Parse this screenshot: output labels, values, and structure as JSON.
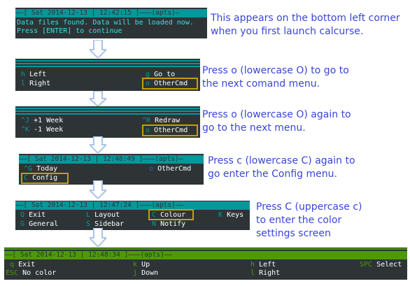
{
  "screens": {
    "s1": {
      "header": "——[ Sat 2014-12-13 | 12:42:15 ]———(apts)—",
      "line1": "Data files found. Data will be loaded now.",
      "line2": "Press [ENTER] to continue"
    },
    "s2": {
      "items": [
        {
          "key": "h",
          "label": "Left"
        },
        {
          "key": "l",
          "label": "Right"
        },
        {
          "key": "g",
          "label": "Go to"
        },
        {
          "key": "o",
          "label": "OtherCmd"
        }
      ]
    },
    "s3": {
      "items": [
        {
          "key": "^J",
          "label": "+1 Week"
        },
        {
          "key": "^K",
          "label": "-1 Week"
        },
        {
          "key": "^R",
          "label": "Redraw"
        },
        {
          "key": "o",
          "label": "OtherCmd"
        }
      ]
    },
    "s4": {
      "header": "——[ Sat 2014-12-13 | 12:46:49 ]———(apts)—",
      "items": [
        {
          "key": "^G",
          "label": "Today"
        },
        {
          "key": "C",
          "label": "Config"
        },
        {
          "key": "o",
          "label": "OtherCmd"
        }
      ]
    },
    "s5": {
      "header": "——[ Sat 2014-12-13 | 12:47:24 ]———(apts)——",
      "items": [
        {
          "key": "Q",
          "label": "Exit"
        },
        {
          "key": "G",
          "label": "General"
        },
        {
          "key": "L",
          "label": "Layout"
        },
        {
          "key": "S",
          "label": "Sidebar"
        },
        {
          "key": "C",
          "label": "Colour"
        },
        {
          "key": "N",
          "label": "Notify"
        },
        {
          "key": "K",
          "label": "Keys"
        }
      ]
    },
    "s6": {
      "header": "——[ Sat 2014-12-13 | 12:48:34 ]———(apts)——",
      "items": [
        {
          "key": "q",
          "label": "Exit"
        },
        {
          "key": "ESC",
          "label": "No color"
        },
        {
          "key": "k",
          "label": "Up"
        },
        {
          "key": "j",
          "label": "Down"
        },
        {
          "key": "h",
          "label": "Left"
        },
        {
          "key": "l",
          "label": "Right"
        },
        {
          "key": "SPC",
          "label": "Select"
        }
      ]
    }
  },
  "notes": {
    "n1": "This appears on the bottom left corner\nwhen you first launch calcurse.",
    "n2": "Press o (lowercase O) to go to\nthe next comand menu.",
    "n3": "Press o (lowercase O) again to\ngo to the next menu.",
    "n4": "Press c (lowercase C) again to\ngo enter the Config menu.",
    "n5": "Press C (uppercase c)\nto enter the color\nsettings screen"
  },
  "colors": {
    "terminal_bg": "#2e3436",
    "cyan": "#06989a",
    "green": "#4e9a06",
    "highlight": "#c4a000",
    "note_text": "#3a46d6",
    "arrow": "#a9c4e6"
  }
}
